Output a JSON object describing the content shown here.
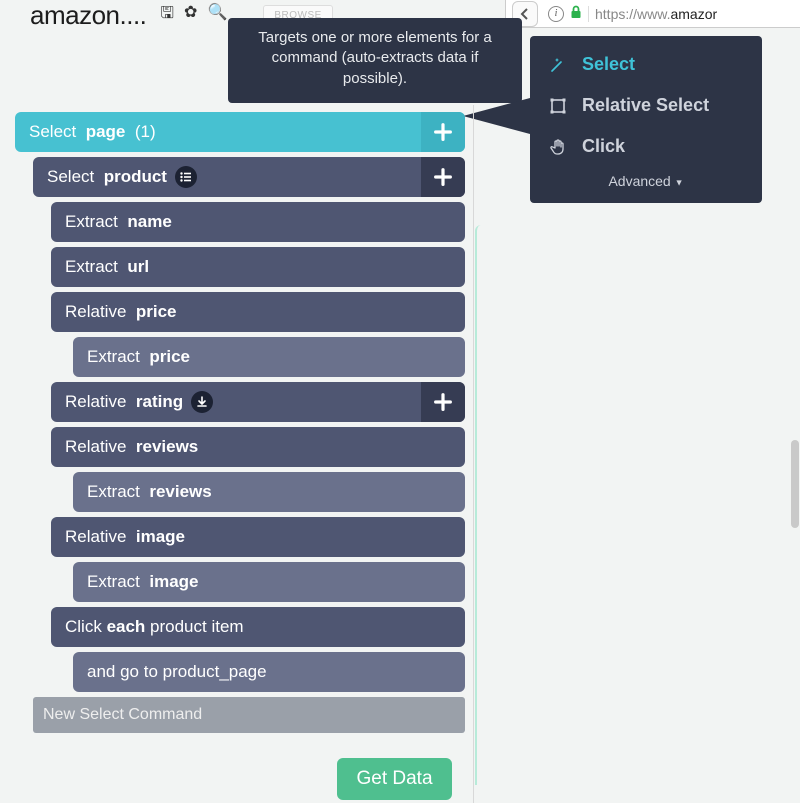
{
  "topbar": {
    "brand": "amazon....",
    "browse_label": "BROWSE",
    "url_prefix": "https://www.",
    "url_bold": "amazor"
  },
  "tooltip": "Targets one or more elements for a command (auto-extracts data if possible).",
  "menu": {
    "items": [
      {
        "label": "Select",
        "active": true,
        "icon": "wand"
      },
      {
        "label": "Relative Select",
        "active": false,
        "icon": "box"
      },
      {
        "label": "Click",
        "active": false,
        "icon": "hand"
      }
    ],
    "advanced_label": "Advanced"
  },
  "commands": {
    "root": {
      "verb": "Select",
      "target": "page",
      "count": "(1)"
    },
    "product": {
      "verb": "Select",
      "target": "product"
    },
    "items": [
      {
        "indent": 2,
        "color": "dark",
        "verb": "Extract",
        "target": "name"
      },
      {
        "indent": 2,
        "color": "dark",
        "verb": "Extract",
        "target": "url"
      },
      {
        "indent": 2,
        "color": "dark",
        "verb": "Relative",
        "target": "price"
      },
      {
        "indent": 3,
        "color": "grey",
        "verb": "Extract",
        "target": "price"
      },
      {
        "indent": 2,
        "color": "dark",
        "verb": "Relative",
        "target": "rating",
        "badge": "download",
        "plus": true
      },
      {
        "indent": 2,
        "color": "dark",
        "verb": "Relative",
        "target": "reviews"
      },
      {
        "indent": 3,
        "color": "grey",
        "verb": "Extract",
        "target": "reviews"
      },
      {
        "indent": 2,
        "color": "dark",
        "verb": "Relative",
        "target": "image"
      },
      {
        "indent": 3,
        "color": "grey",
        "verb": "Extract",
        "target": "image"
      },
      {
        "indent": 2,
        "color": "dark",
        "raw_before": "Click ",
        "raw_bold": "each",
        "raw_after": " product item"
      },
      {
        "indent": 3,
        "color": "grey",
        "raw": "and go to product_page"
      }
    ]
  },
  "new_command_placeholder": "New Select Command",
  "get_data_label": "Get Data"
}
